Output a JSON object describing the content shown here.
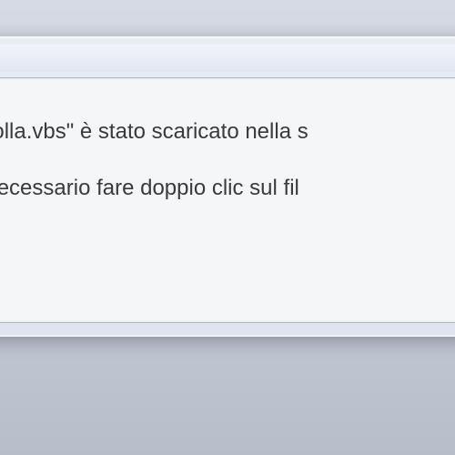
{
  "dialog": {
    "line1": "ontrolla.vbs\" è stato scaricato nella s",
    "line2": ", è necessario fare doppio clic sul fil"
  }
}
